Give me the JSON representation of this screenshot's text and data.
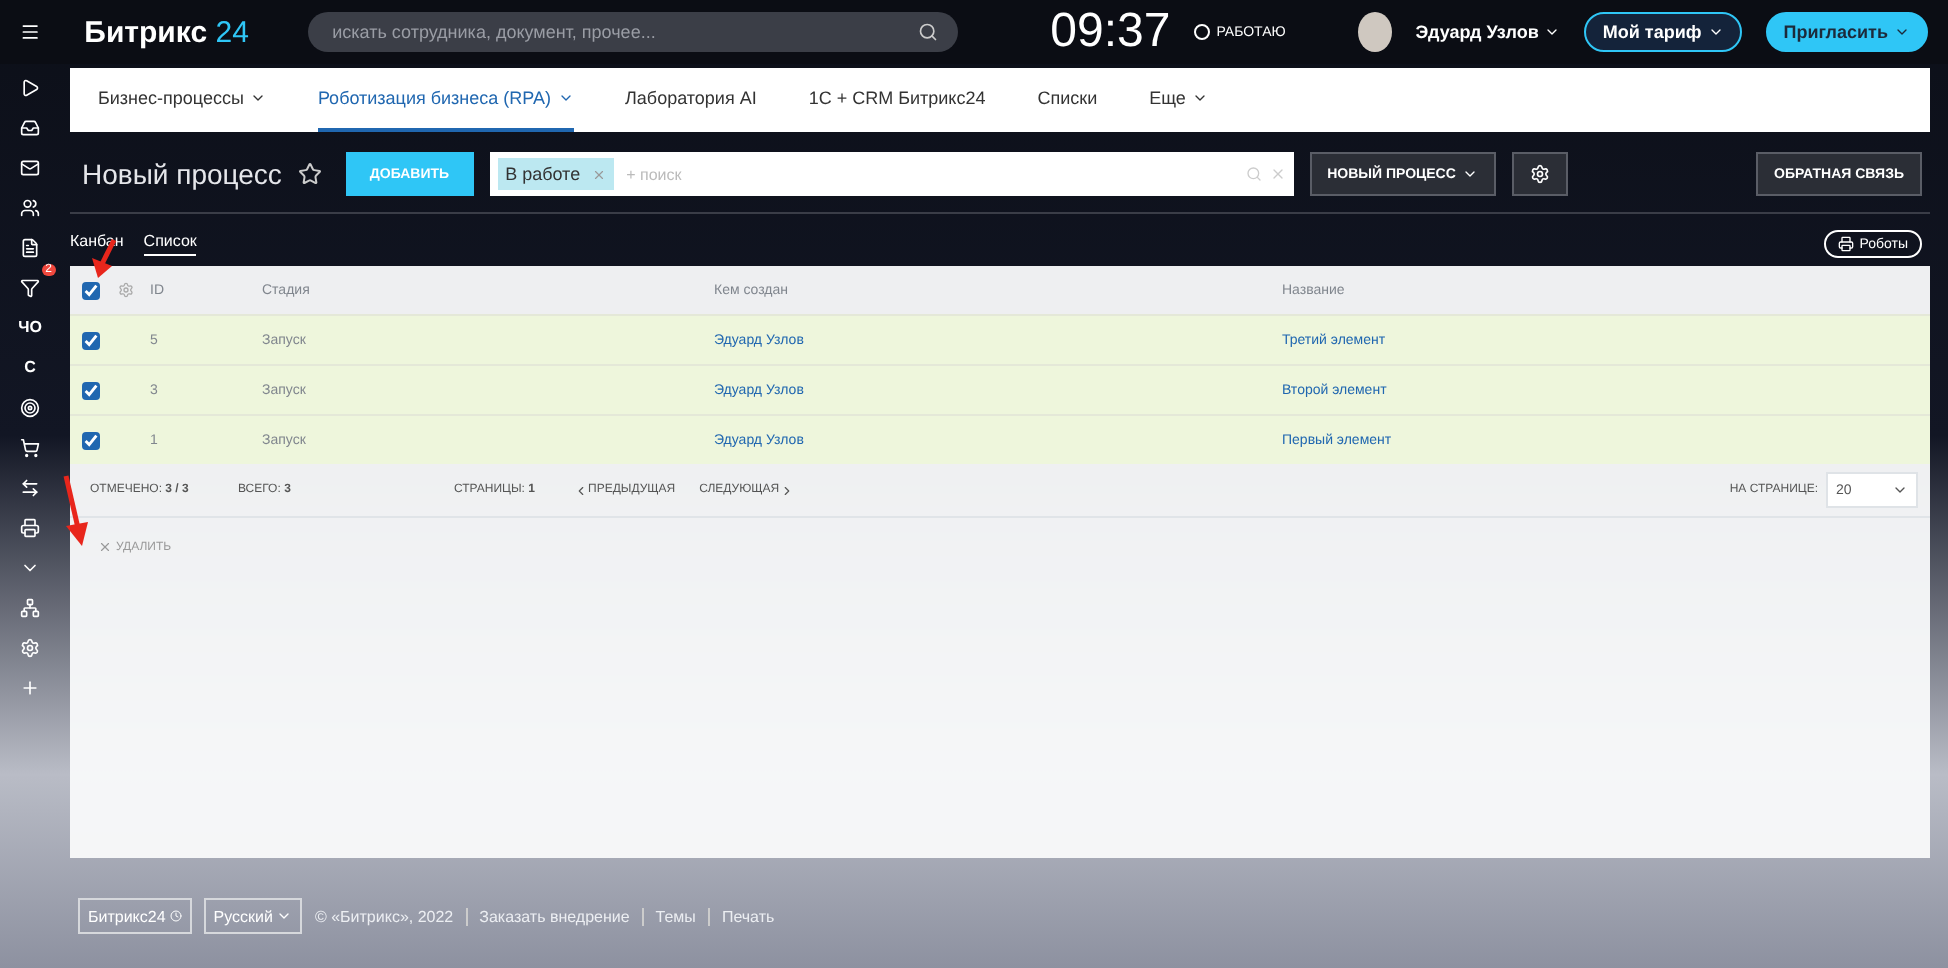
{
  "header": {
    "logo_main": "Битрикс",
    "logo_accent": "24",
    "search": {
      "placeholder": "искать сотрудника, документ, прочее..."
    },
    "time": "09:37",
    "status": "РАБОТАЮ",
    "user": "Эдуард Узлов",
    "tariff": "Мой тариф",
    "invite": "Пригласить"
  },
  "sidebar": [
    {
      "kind": "icon"
    },
    {
      "kind": "icon"
    },
    {
      "kind": "icon"
    },
    {
      "kind": "icon"
    },
    {
      "kind": "icon"
    },
    {
      "kind": "icon",
      "badge": "2"
    },
    {
      "kind": "text",
      "label": "ЧО"
    },
    {
      "kind": "text",
      "label": "С"
    },
    {
      "kind": "icon"
    },
    {
      "kind": "icon"
    },
    {
      "kind": "icon"
    },
    {
      "kind": "icon"
    },
    {
      "kind": "icon"
    },
    {
      "kind": "icon"
    },
    {
      "kind": "icon"
    },
    {
      "kind": "icon"
    }
  ],
  "tabs": [
    {
      "label": "Бизнес-процессы",
      "selected": false,
      "dropdown": true
    },
    {
      "label": "Роботизация бизнеса (RPA)",
      "selected": true,
      "dropdown": true
    },
    {
      "label": "Лаборатория AI",
      "selected": false,
      "dropdown": false
    },
    {
      "label": "1С + CRM Битрикс24",
      "selected": false,
      "dropdown": false
    },
    {
      "label": "Списки",
      "selected": false,
      "dropdown": false
    },
    {
      "label": "Еще",
      "selected": false,
      "dropdown": true
    }
  ],
  "toolbar": {
    "title": "Новый процесс",
    "add": "ДОБАВИТЬ",
    "filter_tag": "В работе",
    "search": {
      "placeholder": "+ поиск"
    },
    "process": "НОВЫЙ ПРОЦЕСС",
    "feedback": "ОБРАТНАЯ СВЯЗЬ"
  },
  "views": [
    {
      "label": "Канбан",
      "selected": false
    },
    {
      "label": "Список",
      "selected": true
    }
  ],
  "robots": "Роботы",
  "table": {
    "all_checked": true,
    "columns": [
      "ID",
      "Стадия",
      "Кем создан",
      "Название"
    ],
    "rows": [
      {
        "selected": true,
        "checked": true,
        "cells": [
          "5",
          "Запуск",
          "Эдуард Узлов",
          "Третий элемент"
        ]
      },
      {
        "selected": true,
        "checked": true,
        "cells": [
          "3",
          "Запуск",
          "Эдуард Узлов",
          "Второй элемент"
        ]
      },
      {
        "selected": true,
        "checked": true,
        "cells": [
          "1",
          "Запуск",
          "Эдуард Узлов",
          "Первый элемент"
        ]
      }
    ]
  },
  "pager": {
    "marked_label": "ОТМЕЧЕНО:",
    "marked": "3 / 3",
    "total_label": "ВСЕГО:",
    "total": "3",
    "pages_label": "СТРАНИЦЫ:",
    "pages": "1",
    "prev": "ПРЕДЫДУЩАЯ",
    "next": "СЛЕДУЮЩАЯ",
    "per_page_label": "НА СТРАНИЦЕ:",
    "per_page": "20"
  },
  "delete": "УДАЛИТЬ",
  "footer": {
    "logo": "Битрикс24",
    "language": "Русский",
    "copyright": "© «Битрикс», 2022",
    "links": [
      "Заказать внедрение",
      "Темы",
      "Печать"
    ]
  }
}
